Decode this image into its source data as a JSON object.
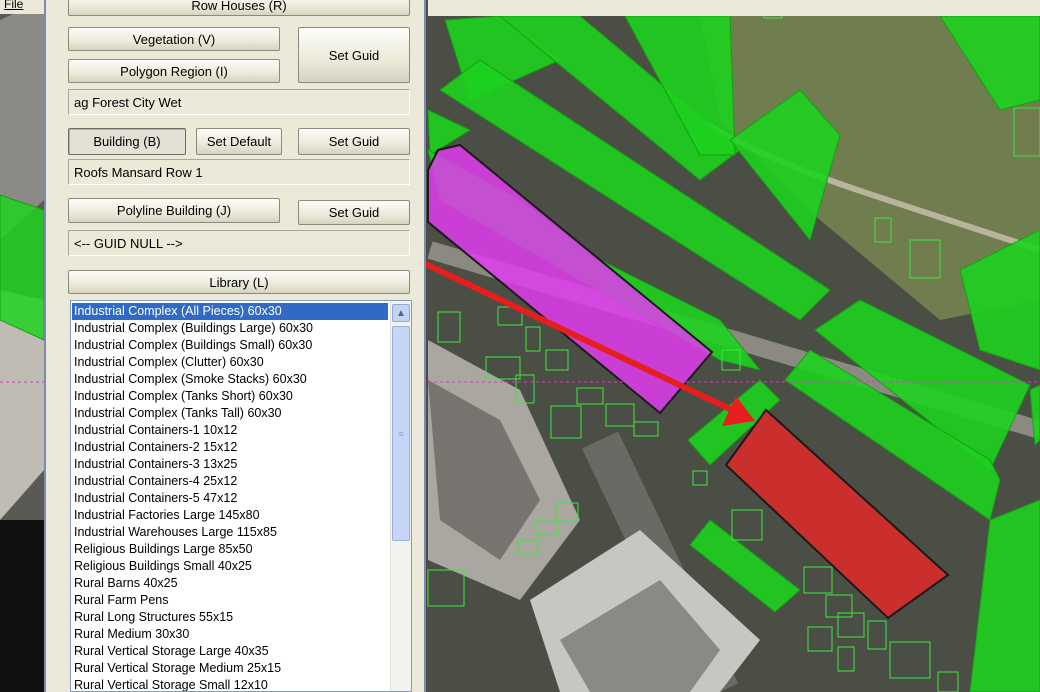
{
  "menu": {
    "file": "File"
  },
  "panel": {
    "row_houses_button": "Row Houses (R)",
    "vegetation_button": "Vegetation (V)",
    "polygon_region_button": "Polygon Region (I)",
    "set_guid_button_1": "Set Guid",
    "vegetation_value": "ag Forest City Wet",
    "building_button": "Building (B)",
    "set_default_button": "Set Default",
    "set_guid_button_2": "Set Guid",
    "building_value": "Roofs Mansard Row 1",
    "polyline_building_button": "Polyline Building (J)",
    "set_guid_button_3": "Set Guid",
    "polyline_value": "<-- GUID NULL -->",
    "library_button": "Library (L)"
  },
  "library_list": {
    "selected_index": 0,
    "items": [
      "Industrial Complex (All Pieces) 60x30",
      "Industrial Complex (Buildings Large) 60x30",
      "Industrial Complex (Buildings Small) 60x30",
      "Industrial Complex (Clutter) 60x30",
      "Industrial Complex (Smoke Stacks) 60x30",
      "Industrial Complex (Tanks Short) 60x30",
      "Industrial Complex (Tanks Tall) 60x30",
      "Industrial Containers-1 10x12",
      "Industrial Containers-2 15x12",
      "Industrial Containers-3 13x25",
      "Industrial Containers-4 25x12",
      "Industrial Containers-5 47x12",
      "Industrial Factories Large 145x80",
      "Industrial Warehouses Large 115x85",
      "Religious Buildings Large 85x50",
      "Religious Buildings Small 40x25",
      "Rural Barns 40x25",
      "Rural Farm Pens",
      "Rural Long Structures  55x15",
      "Rural Medium 30x30",
      "Rural Vertical Storage Large 40x35",
      "Rural Vertical Storage Medium 25x15",
      "Rural Vertical Storage Small 12x10"
    ]
  },
  "colors": {
    "vegetation": "#1ed21e",
    "selected_building": "#e03cf0",
    "new_building": "#e62828",
    "arrow": "#e61e1e",
    "list_selection": "#316ac5"
  }
}
